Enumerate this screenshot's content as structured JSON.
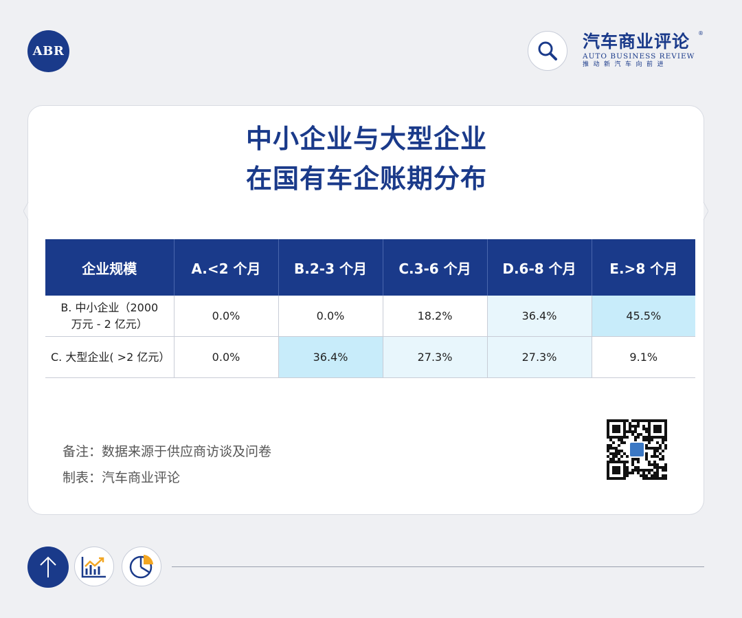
{
  "header": {
    "logo_text": "ABR",
    "brand_cn": "汽车商业评论",
    "brand_reg": "®",
    "brand_en": "AUTO BUSINESS REVIEW",
    "brand_slogan": "推动新汽车向前进"
  },
  "card": {
    "title_line1": "中小企业与大型企业",
    "title_line2": "在国有车企账期分布",
    "note_source": "备注：数据来源于供应商访谈及问卷",
    "note_maker": "制表：汽车商业评论"
  },
  "chart_data": {
    "type": "table",
    "title": "中小企业与大型企业在国有车企账期分布",
    "columns": [
      "企业规模",
      "A.<2 个月",
      "B.2-3 个月",
      "C.3-6 个月",
      "D.6-8 个月",
      "E.>8 个月"
    ],
    "rows": [
      {
        "label_line1": "B. 中小企业（2000",
        "label_line2": "万元 - 2 亿元）",
        "cells": [
          "0.0%",
          "0.0%",
          "18.2%",
          "36.4%",
          "45.5%"
        ],
        "values": [
          0.0,
          0.0,
          18.2,
          36.4,
          45.5
        ]
      },
      {
        "label_line1": "C. 大型企业(  >2 亿元）",
        "label_line2": "",
        "cells": [
          "0.0%",
          "36.4%",
          "27.3%",
          "27.3%",
          "9.1%"
        ],
        "values": [
          0.0,
          36.4,
          27.3,
          27.3,
          9.1
        ]
      }
    ],
    "heat_colors": {
      "high": "#c8ecfa",
      "mid": "#e8f6fc",
      "none": "#ffffff"
    }
  },
  "colors": {
    "accent": "#1a3a8a",
    "background": "#eff0f3"
  },
  "icons": {
    "search": "search-icon",
    "up": "arrow-up-icon",
    "bar": "bar-chart-trend-icon",
    "pie": "pie-chart-icon",
    "qr": "qr-code"
  }
}
